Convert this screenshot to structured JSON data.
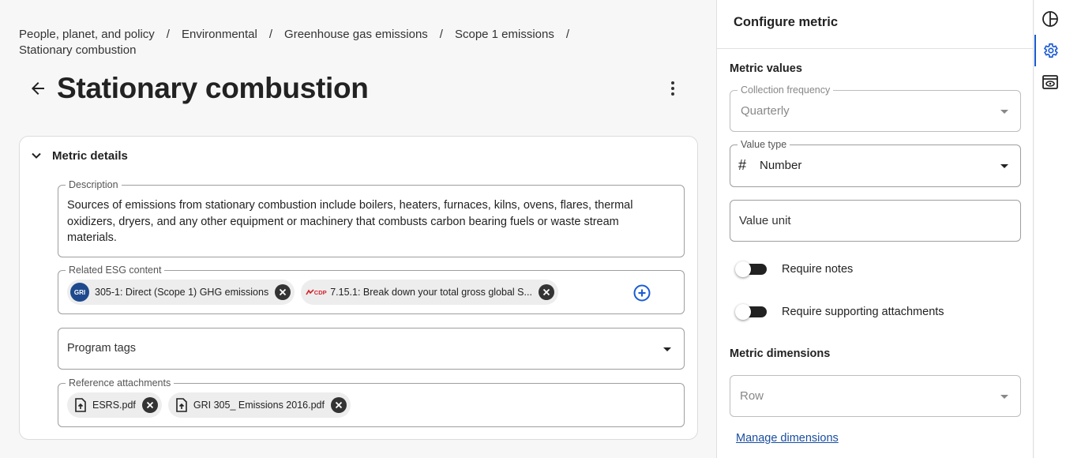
{
  "breadcrumb": {
    "items": [
      "People, planet, and policy",
      "Environmental",
      "Greenhouse gas emissions",
      "Scope 1 emissions"
    ],
    "separator": "/",
    "current": "Stationary combustion"
  },
  "page": {
    "title": "Stationary combustion"
  },
  "metric_details": {
    "header": "Metric details",
    "description_label": "Description",
    "description": "Sources of emissions from stationary combustion include boilers, heaters, furnaces, kilns, ovens, flares, thermal oxidizers, dryers, and any other equipment or machinery that combusts carbon bearing fuels or waste stream materials.",
    "related_label": "Related ESG content",
    "related_items": [
      {
        "logo": "GRI",
        "label": "305-1: Direct (Scope 1) GHG emissions"
      },
      {
        "logo": "CDP",
        "label": "7.15.1: Break down your total gross global S..."
      }
    ],
    "program_tags_placeholder": "Program tags",
    "attachments_label": "Reference attachments",
    "attachments": [
      "ESRS.pdf",
      "GRI 305_ Emissions 2016.pdf"
    ]
  },
  "panel": {
    "title": "Configure metric",
    "values_section": "Metric values",
    "collection_frequency": {
      "label": "Collection frequency",
      "value": "Quarterly"
    },
    "value_type": {
      "label": "Value type",
      "value": "Number",
      "symbol": "#"
    },
    "value_unit": {
      "placeholder": "Value unit"
    },
    "require_notes": "Require notes",
    "require_attachments": "Require supporting attachments",
    "dimensions_section": "Metric dimensions",
    "row_placeholder": "Row",
    "manage_link": "Manage dimensions"
  },
  "rail": {
    "icons": [
      "chart-pie-icon",
      "gear-icon",
      "preview-icon"
    ],
    "active": "gear-icon"
  },
  "colors": {
    "accent": "#1a5bd3",
    "link": "#1a4ea0",
    "gri_brand": "#1e4a8d",
    "cdp_brand": "#d4232b",
    "dark": "#222222"
  }
}
